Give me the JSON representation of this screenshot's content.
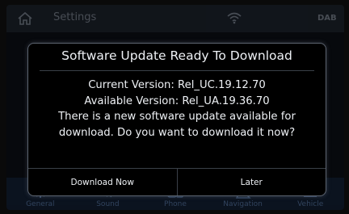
{
  "background": {
    "title": "Settings",
    "status_right": "DAB",
    "icons": [
      "home-icon",
      "wifi-icon"
    ],
    "nav": [
      {
        "label": "General",
        "icon": "gear-icon"
      },
      {
        "label": "Sound",
        "icon": "speaker-icon"
      },
      {
        "label": "Phone",
        "icon": "phone-icon"
      },
      {
        "label": "Navigation",
        "icon": "map-icon"
      },
      {
        "label": "Vehicle",
        "icon": "car-icon"
      }
    ]
  },
  "dialog": {
    "title": "Software Update Ready To Download",
    "current_version": "Current Version: Rel_UC.19.12.70",
    "available_version": "Available Version: Rel_UA.19.36.70",
    "message_line1": "There is a new software update available for",
    "message_line2": "download. Do you want to download it now?",
    "download_label": "Download Now",
    "later_label": "Later"
  },
  "colors": {
    "dialog_background": "#000000",
    "dialog_border": "#5c6470",
    "text": "#eef1f5",
    "nav_background": "#0f1a2b"
  }
}
